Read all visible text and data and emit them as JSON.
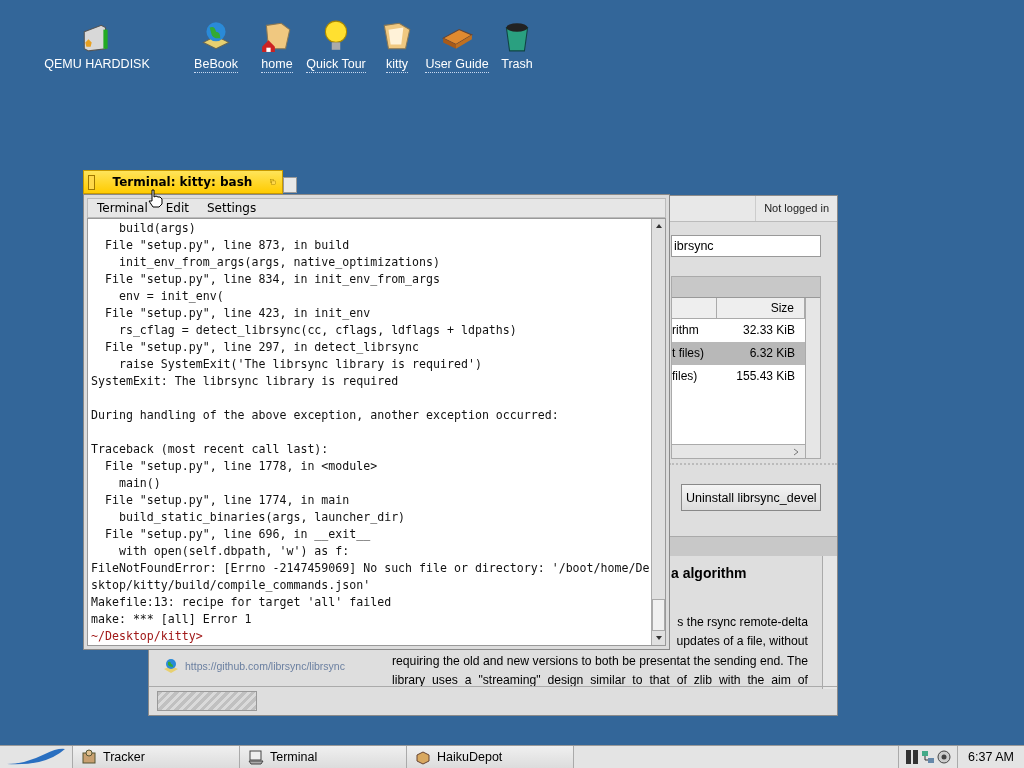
{
  "desktop_icons": [
    {
      "label": "QEMU HARDDISK",
      "link": false
    },
    {
      "label": "BeBook",
      "link": true
    },
    {
      "label": "home",
      "link": true
    },
    {
      "label": "Quick Tour",
      "link": true
    },
    {
      "label": "kitty",
      "link": true
    },
    {
      "label": "User Guide",
      "link": true
    },
    {
      "label": "Trash",
      "link": false
    }
  ],
  "depot": {
    "account": "Not logged in",
    "search_value": "ibrsync",
    "table": {
      "columns": [
        "Size"
      ],
      "rows": [
        {
          "name": "rithm",
          "size": "32.33 KiB",
          "selected": false
        },
        {
          "name": "t files)",
          "size": "6.32 KiB",
          "selected": true
        },
        {
          "name": "files)",
          "size": "155.43 KiB",
          "selected": false
        }
      ]
    },
    "button": "Uninstall librsync_devel",
    "description": {
      "heading": "a algorithm",
      "lines": [
        {
          "text": "s the rsync remote-delta",
          "kind": "tail"
        },
        {
          "text": "updates of a file, without",
          "kind": "tail"
        },
        {
          "text": "requiring the old and new versions to both be presentat the sending end. The",
          "kind": "full"
        },
        {
          "text": "library uses a \"streaming\" design similar to that of zlib with the aim of",
          "kind": "full"
        }
      ]
    },
    "link": "https://github.com/librsync/librsync"
  },
  "terminal": {
    "title": "Terminal: kitty: bash",
    "menus": [
      "Terminal",
      "Edit",
      "Settings"
    ],
    "lines": [
      {
        "text": "    build(args)",
        "kind": "output"
      },
      {
        "text": "  File \"setup.py\", line 873, in build",
        "kind": "output"
      },
      {
        "text": "    init_env_from_args(args, native_optimizations)",
        "kind": "output"
      },
      {
        "text": "  File \"setup.py\", line 834, in init_env_from_args",
        "kind": "output"
      },
      {
        "text": "    env = init_env(",
        "kind": "output"
      },
      {
        "text": "  File \"setup.py\", line 423, in init_env",
        "kind": "output"
      },
      {
        "text": "    rs_cflag = detect_librsync(cc, cflags, ldflags + ldpaths)",
        "kind": "output"
      },
      {
        "text": "  File \"setup.py\", line 297, in detect_librsync",
        "kind": "output"
      },
      {
        "text": "    raise SystemExit('The librsync library is required')",
        "kind": "output"
      },
      {
        "text": "SystemExit: The librsync library is required",
        "kind": "output"
      },
      {
        "kind": "blank"
      },
      {
        "text": "During handling of the above exception, another exception occurred:",
        "kind": "output"
      },
      {
        "kind": "blank"
      },
      {
        "text": "Traceback (most recent call last):",
        "kind": "output"
      },
      {
        "text": "  File \"setup.py\", line 1778, in <module>",
        "kind": "output"
      },
      {
        "text": "    main()",
        "kind": "output"
      },
      {
        "text": "  File \"setup.py\", line 1774, in main",
        "kind": "output"
      },
      {
        "text": "    build_static_binaries(args, launcher_dir)",
        "kind": "output"
      },
      {
        "text": "  File \"setup.py\", line 696, in __exit__",
        "kind": "output"
      },
      {
        "text": "    with open(self.dbpath, 'w') as f:",
        "kind": "output"
      },
      {
        "text": "FileNotFoundError: [Errno -2147459069] No such file or directory: '/boot/home/De",
        "kind": "output"
      },
      {
        "text": "sktop/kitty/build/compile_commands.json'",
        "kind": "output"
      },
      {
        "text": "Makefile:13: recipe for target 'all' failed",
        "kind": "output"
      },
      {
        "text": "make: *** [all] Error 1",
        "kind": "output"
      },
      {
        "text": "~/Desktop/kitty>",
        "kind": "prompt"
      }
    ]
  },
  "taskbar": {
    "items": [
      {
        "label": "Tracker"
      },
      {
        "label": "Terminal"
      },
      {
        "label": "HaikuDepot"
      }
    ],
    "clock": "6:37 AM"
  }
}
